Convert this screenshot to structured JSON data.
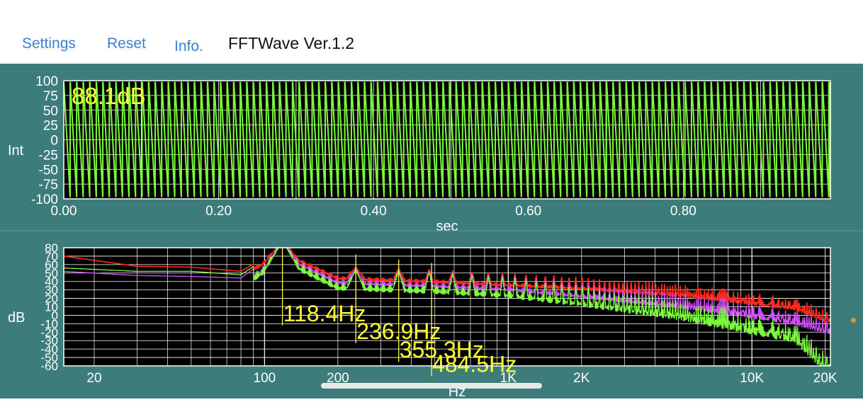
{
  "toolbar": {
    "settings_label": "Settings",
    "reset_label": "Reset",
    "info_label": "Info.",
    "app_title": "FFTWave Ver.1.2"
  },
  "colors": {
    "panel_bg": "#3c7d7b",
    "plot_bg": "#000000",
    "grid": "#ffffff",
    "wave": "#7cfc3c",
    "spectrum_red": "#ff2a1a",
    "spectrum_magenta": "#d24dff",
    "spectrum_green": "#7cfc3c",
    "marker_yellow": "#ffff33",
    "link_blue": "#3b82d6",
    "dot_orange": "#d99a3a"
  },
  "waveform": {
    "level_label": "88.1dB",
    "y_axis_label": "Int",
    "x_axis_label": "sec",
    "y_ticks": [
      "100",
      "75",
      "50",
      "25",
      "0",
      "-25",
      "-50",
      "-75",
      "-100"
    ],
    "x_ticks": [
      "0.00",
      "0.20",
      "0.40",
      "0.60",
      "0.80"
    ]
  },
  "spectrum": {
    "y_axis_label": "dB",
    "x_axis_label": "Hz",
    "y_ticks": [
      "80",
      "70",
      "60",
      "50",
      "40",
      "30",
      "20",
      "10",
      "0",
      "-10",
      "-20",
      "-30",
      "-40",
      "-50",
      "-60"
    ],
    "x_ticks": [
      "20",
      "100",
      "200",
      "1K",
      "2K",
      "10K",
      "20K"
    ],
    "peak_labels": [
      "118.4Hz",
      "236.9Hz",
      "355.3Hz",
      "484.5Hz"
    ]
  },
  "chart_data": [
    {
      "type": "line",
      "title": "",
      "level": "88.1dB",
      "xlabel": "sec",
      "ylabel": "Int",
      "xlim": [
        0.0,
        0.99
      ],
      "ylim": [
        -100,
        100
      ],
      "grid": true,
      "x_ticks": [
        0.0,
        0.2,
        0.4,
        0.6,
        0.8
      ],
      "y_ticks": [
        100,
        75,
        50,
        25,
        0,
        -25,
        -50,
        -75,
        -100
      ],
      "signal": {
        "waveform": "sawtooth",
        "frequency_hz": 118.4,
        "min": -97,
        "max": 97
      }
    },
    {
      "type": "line",
      "title": "",
      "xlabel": "Hz",
      "ylabel": "dB",
      "x_scale": "log",
      "xlim": [
        15,
        21000
      ],
      "ylim": [
        -60,
        80
      ],
      "grid": true,
      "x_ticks": [
        "20",
        "100",
        "200",
        "1K",
        "2K",
        "10K",
        "20K"
      ],
      "y_ticks": [
        80,
        70,
        60,
        50,
        40,
        30,
        20,
        10,
        0,
        -10,
        -20,
        -30,
        -40,
        -50,
        -60
      ],
      "peaks": [
        {
          "freq": 118.4,
          "label": "118.4Hz",
          "db": 80
        },
        {
          "freq": 236.9,
          "label": "236.9Hz",
          "db": 72
        },
        {
          "freq": 355.3,
          "label": "355.3Hz",
          "db": 66
        },
        {
          "freq": 484.5,
          "label": "484.5Hz",
          "db": 62
        }
      ],
      "series": [
        {
          "color": "#ff2a1a",
          "x": [
            15,
            30,
            50,
            80,
            118,
            200,
            500,
            1000,
            2000,
            5000,
            10000,
            15000,
            20000
          ],
          "y": [
            70,
            58,
            57,
            52,
            80,
            50,
            46,
            42,
            38,
            30,
            20,
            14,
            0
          ]
        },
        {
          "color": "#d24dff",
          "x": [
            15,
            30,
            50,
            80,
            118,
            200,
            500,
            1000,
            2000,
            5000,
            10000,
            15000,
            20000
          ],
          "y": [
            52,
            47,
            46,
            44,
            80,
            48,
            44,
            40,
            32,
            20,
            8,
            0,
            -10
          ]
        },
        {
          "color": "#7cfc3c",
          "x": [
            15,
            30,
            50,
            80,
            118,
            200,
            500,
            1000,
            2000,
            5000,
            10000,
            15000,
            20000
          ],
          "y": [
            56,
            52,
            52,
            48,
            80,
            47,
            43,
            38,
            28,
            12,
            -5,
            -15,
            -50
          ]
        }
      ]
    }
  ]
}
